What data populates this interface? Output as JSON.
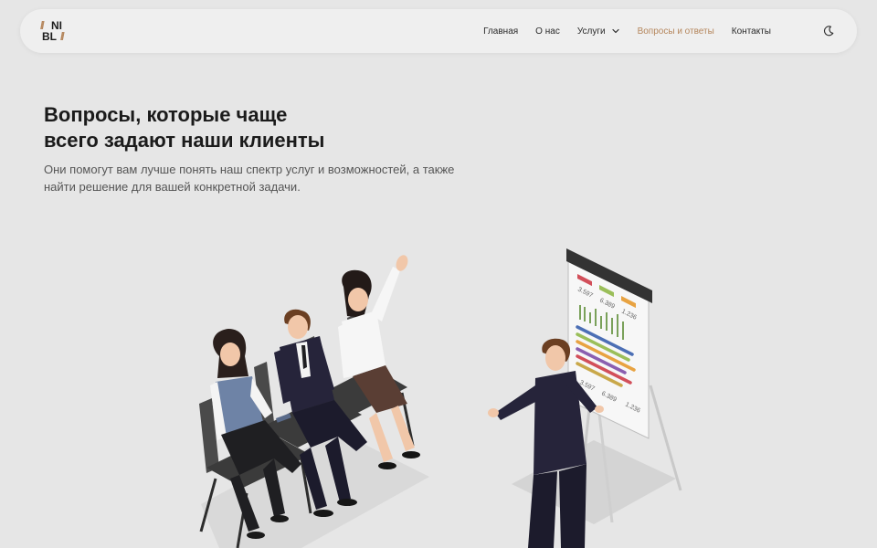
{
  "brand": {
    "logo_text_1": "NI",
    "logo_text_2": "BL",
    "slash": "//"
  },
  "nav": {
    "items": [
      {
        "label": "Главная"
      },
      {
        "label": "О нас"
      },
      {
        "label": "Услуги"
      },
      {
        "label": "Вопросы и ответы"
      },
      {
        "label": "Контакты"
      }
    ],
    "active_index": 3,
    "accent_color": "#b5865c",
    "theme_icon": "moon-icon"
  },
  "hero": {
    "title_line1": "Вопросы, которые чаще",
    "title_line2": "всего задают наши клиенты",
    "subtitle_line1": "Они помогут вам лучше понять наш спектр услуг и возможностей, а также",
    "subtitle_line2": "найти решение для вашей конкретной задачи."
  },
  "illustration": {
    "board_numbers": [
      "3.597",
      "6.389",
      "1.236",
      "3.597",
      "6.389",
      "1.236"
    ]
  }
}
